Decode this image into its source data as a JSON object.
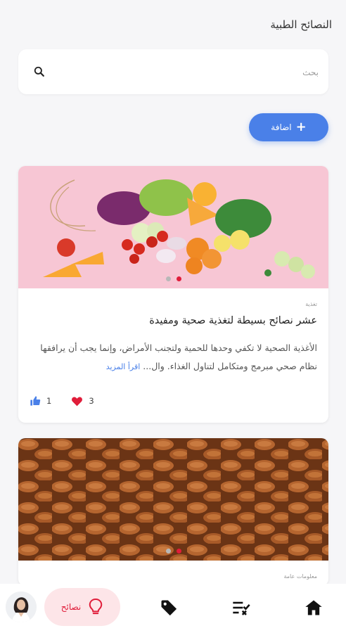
{
  "header": {
    "title": "النصائح الطبية"
  },
  "search": {
    "placeholder": "بحث"
  },
  "add_button": {
    "label": "اضافة"
  },
  "cards": [
    {
      "category": "تغذية",
      "title": "عشر نصائح بسيطة لتغذية صحية ومفيدة",
      "description": "الأغذية الصحية لا تكفي وحدها للحمية ولتجنب الأمراض، وإنما يجب أن يرافقها نظام صحي مبرمج ومتكامل لتناول الغذاء. وال...",
      "read_more": "اقرأ المزيد",
      "likes": "1",
      "hearts": "3"
    },
    {
      "category": "معلومات عامة"
    }
  ],
  "bottom_nav": {
    "tips_label": "نصائح"
  },
  "colors": {
    "accent": "#4a80e8",
    "red": "#e01d3a"
  }
}
